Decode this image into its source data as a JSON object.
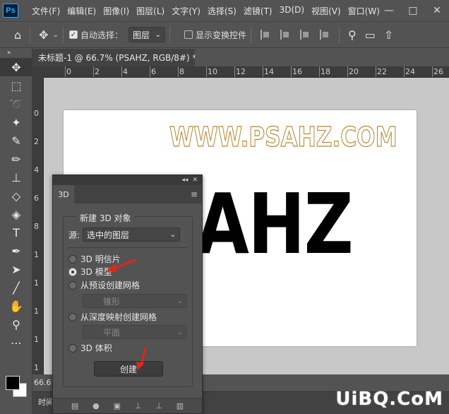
{
  "menubar": {
    "logo": "Ps",
    "items": [
      "文件(F)",
      "编辑(E)",
      "图像(I)",
      "图层(L)",
      "文字(Y)",
      "选择(S)",
      "滤镜(T)",
      "3D(D)",
      "视图(V)",
      "窗口(W)"
    ],
    "controls": [
      "—",
      "□",
      "✕"
    ]
  },
  "options": {
    "auto_select_label": "自动选择：",
    "auto_select_checked": true,
    "target_value": "图层",
    "show_transform_label": "显示变换控件",
    "show_transform_checked": false
  },
  "document": {
    "tab_title": "未标题-1 @ 66.7% (PSAHZ, RGB/8#) *",
    "watermark_text": "WWW.PSAHZ.COM",
    "main_text": "PSAHZ",
    "main_text_visible": "SAHZ"
  },
  "ruler": {
    "h_labels": [
      "0",
      "2",
      "4",
      "6",
      "8",
      "10",
      "12",
      "14",
      "16",
      "18",
      "20",
      "22",
      "24",
      "26"
    ],
    "v_labels": [
      "0",
      "2",
      "4",
      "6",
      "8",
      "1",
      "1",
      "1",
      "1",
      "1"
    ]
  },
  "status": {
    "zoom": "66.67",
    "timeline_tab": "时间"
  },
  "panel3d": {
    "tab": "3D",
    "heading": "新建 3D 对象",
    "source_label": "源:",
    "source_value": "选中的图层",
    "options": [
      {
        "label": "3D 明信片",
        "selected": false
      },
      {
        "label": "3D 模型",
        "selected": true
      },
      {
        "label": "从预设创建网格",
        "selected": false
      },
      {
        "label": "从深度映射创建网格",
        "selected": false
      },
      {
        "label": "3D 体积",
        "selected": false
      }
    ],
    "preset_value": "锥形",
    "depth_value": "平面",
    "create_label": "创建"
  },
  "site_watermark": "UiBQ.CoM",
  "colors": {
    "accent_arrow": "#e0261c",
    "foreground": "#000000",
    "background": "#ffffff"
  }
}
